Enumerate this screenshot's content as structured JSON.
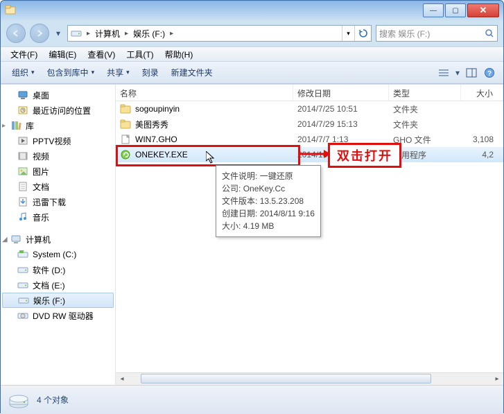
{
  "window_title": "",
  "win_controls": {
    "min": "—",
    "max": "▢",
    "close": "✕"
  },
  "nav": {
    "seg1": "计算机",
    "seg2": "娱乐 (F:)",
    "search_placeholder": "搜索 娱乐 (F:)"
  },
  "menu": {
    "file": "文件(F)",
    "edit": "编辑(E)",
    "view": "查看(V)",
    "tools": "工具(T)",
    "help": "帮助(H)"
  },
  "toolbar": {
    "organize": "组织",
    "include": "包含到库中",
    "share": "共享",
    "burn": "刻录",
    "newfolder": "新建文件夹"
  },
  "sidebar": {
    "desktop": "桌面",
    "recent": "最近访问的位置",
    "libraries": "库",
    "pptv": "PPTV视频",
    "video": "视频",
    "pictures": "图片",
    "documents": "文档",
    "xunlei": "迅雷下载",
    "music": "音乐",
    "computer": "计算机",
    "drive_c": "System (C:)",
    "drive_d": "软件 (D:)",
    "drive_e": "文档 (E:)",
    "drive_f": "娱乐 (F:)",
    "dvd": "DVD RW 驱动器"
  },
  "columns": {
    "name": "名称",
    "date": "修改日期",
    "type": "类型",
    "size": "大小"
  },
  "files": [
    {
      "name": "sogoupinyin",
      "date": "2014/7/25 10:51",
      "type": "文件夹",
      "size": ""
    },
    {
      "name": "美图秀秀",
      "date": "2014/7/29 15:13",
      "type": "文件夹",
      "size": ""
    },
    {
      "name": "WIN7.GHO",
      "date": "2014/7/7 1:13",
      "type": "GHO 文件",
      "size": "3,108"
    },
    {
      "name": "ONEKEY.EXE",
      "date": "2014/10",
      "type": "应用程序",
      "size": "4,2"
    }
  ],
  "tooltip": {
    "l1_label": "文件说明:",
    "l1_val": "一键还原",
    "l2_label": "公司:",
    "l2_val": "OneKey.Cc",
    "l3_label": "文件版本:",
    "l3_val": "13.5.23.208",
    "l4_label": "创建日期:",
    "l4_val": "2014/8/11 9:16",
    "l5_label": "大小:",
    "l5_val": "4.19 MB"
  },
  "callout": "双击打开",
  "status": {
    "count": "4 个对象"
  }
}
